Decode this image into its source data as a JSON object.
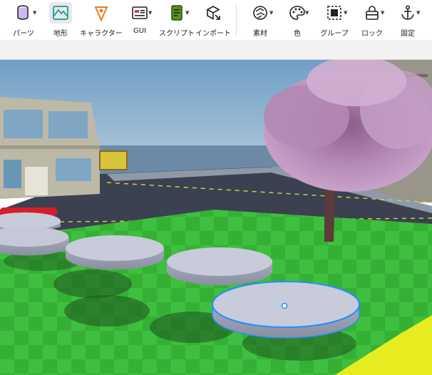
{
  "toolbar": {
    "tools": [
      {
        "label": "パーツ",
        "icon": "part-cylinder-icon"
      },
      {
        "label": "地形",
        "icon": "terrain-icon"
      },
      {
        "label": "キャラクター",
        "icon": "character-icon"
      },
      {
        "label": "GUI",
        "icon": "gui-icon"
      },
      {
        "label": "スクリプト",
        "icon": "script-icon"
      },
      {
        "label": "インポート",
        "icon": "import-icon"
      },
      {
        "label": "素材",
        "icon": "material-icon"
      },
      {
        "label": "色",
        "icon": "color-palette-icon"
      },
      {
        "label": "グループ",
        "icon": "group-icon"
      },
      {
        "label": "ロック",
        "icon": "lock-icon"
      },
      {
        "label": "固定",
        "icon": "anchor-icon"
      }
    ],
    "active_tool": "地形",
    "colors": {
      "terrain": "#1f9a8a",
      "character": "#f07a1e",
      "gui": "#d8336e",
      "script": "#5a8f1e"
    }
  },
  "viewport": {
    "description_objects": [
      "building-left",
      "cherry-tree",
      "road",
      "grass-plane",
      "cylinder-parts",
      "yellow-part"
    ],
    "selection_color": "#1e90ff"
  }
}
